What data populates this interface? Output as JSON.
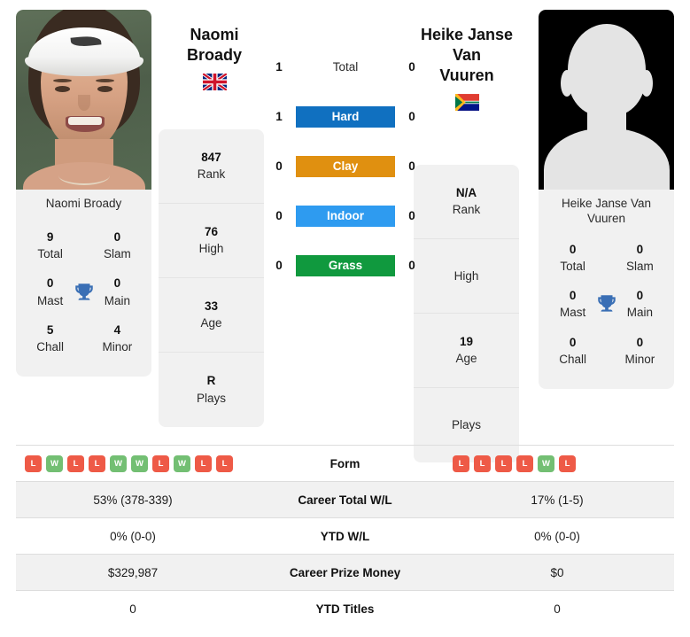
{
  "players": {
    "left": {
      "name_line1": "Naomi",
      "name_line2": "Broady",
      "caption": "Naomi Broady",
      "flag": "gb-flag",
      "info": [
        {
          "value": "847",
          "label": "Rank"
        },
        {
          "value": "76",
          "label": "High"
        },
        {
          "value": "33",
          "label": "Age"
        },
        {
          "value": "R",
          "label": "Plays"
        }
      ],
      "titles": [
        {
          "value": "9",
          "label": "Total"
        },
        {
          "value": "0",
          "label": "Slam"
        },
        {
          "value": "0",
          "label": "Mast"
        },
        {
          "value": "0",
          "label": "Main"
        },
        {
          "value": "5",
          "label": "Chall"
        },
        {
          "value": "4",
          "label": "Minor"
        }
      ],
      "form": [
        "L",
        "W",
        "L",
        "L",
        "W",
        "W",
        "L",
        "W",
        "L",
        "L"
      ],
      "career_wl": "53% (378-339)",
      "ytd_wl": "0% (0-0)",
      "prize_money": "$329,987",
      "ytd_titles": "0"
    },
    "right": {
      "name_line1": "Heike Janse Van",
      "name_line2": "Vuuren",
      "caption_line1": "Heike Janse Van",
      "caption_line2": "Vuuren",
      "flag": "za-flag",
      "info": [
        {
          "value": "N/A",
          "label": "Rank"
        },
        {
          "value": "",
          "label": "High"
        },
        {
          "value": "19",
          "label": "Age"
        },
        {
          "value": "",
          "label": "Plays"
        }
      ],
      "titles": [
        {
          "value": "0",
          "label": "Total"
        },
        {
          "value": "0",
          "label": "Slam"
        },
        {
          "value": "0",
          "label": "Mast"
        },
        {
          "value": "0",
          "label": "Main"
        },
        {
          "value": "0",
          "label": "Chall"
        },
        {
          "value": "0",
          "label": "Minor"
        }
      ],
      "form": [
        "L",
        "L",
        "L",
        "L",
        "W",
        "L"
      ],
      "career_wl": "17% (1-5)",
      "ytd_wl": "0% (0-0)",
      "prize_money": "$0",
      "ytd_titles": "0"
    }
  },
  "surfaces": [
    {
      "label": "Total",
      "left": "1",
      "right": "0",
      "color": "none",
      "style": "plain"
    },
    {
      "label": "Hard",
      "left": "1",
      "right": "0",
      "color": "#1070c0",
      "style": "bar"
    },
    {
      "label": "Clay",
      "left": "0",
      "right": "0",
      "color": "#e09010",
      "style": "bar"
    },
    {
      "label": "Indoor",
      "left": "0",
      "right": "0",
      "color": "#2e9bf0",
      "style": "bar"
    },
    {
      "label": "Grass",
      "left": "0",
      "right": "0",
      "color": "#10993e",
      "style": "bar"
    }
  ],
  "stats_rows": [
    {
      "label": "Form",
      "kind": "form"
    },
    {
      "label": "Career Total W/L",
      "kind": "text",
      "left": "53% (378-339)",
      "right": "17% (1-5)"
    },
    {
      "label": "YTD W/L",
      "kind": "text",
      "left": "0% (0-0)",
      "right": "0% (0-0)"
    },
    {
      "label": "Career Prize Money",
      "kind": "text",
      "left": "$329,987",
      "right": "$0"
    },
    {
      "label": "YTD Titles",
      "kind": "text",
      "left": "0",
      "right": "0"
    }
  ],
  "colors": {
    "hard": "#1070c0",
    "clay": "#e09010",
    "indoor": "#2e9bf0",
    "grass": "#10993e",
    "win_badge": "#73bf73",
    "loss_badge": "#ee5a47",
    "trophy": "#3a6fb5",
    "panel_bg": "#f1f1f1"
  }
}
